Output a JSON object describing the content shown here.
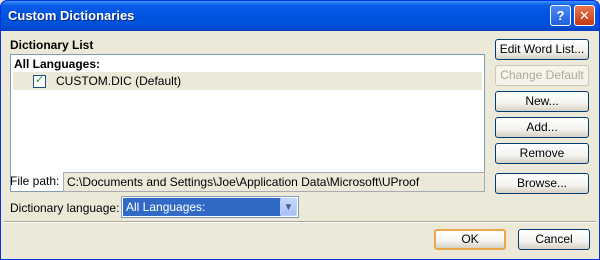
{
  "window": {
    "title": "Custom Dictionaries",
    "help_glyph": "?",
    "close_glyph": "✕"
  },
  "list": {
    "label": "Dictionary List",
    "group_header": "All Languages:",
    "items": [
      {
        "label": "CUSTOM.DIC (Default)",
        "checked": true
      }
    ]
  },
  "buttons": {
    "edit_word_list": "Edit Word List...",
    "change_default": "Change Default",
    "new": "New...",
    "add": "Add...",
    "remove": "Remove",
    "browse": "Browse...",
    "ok": "OK",
    "cancel": "Cancel"
  },
  "file_path": {
    "label": "File path:",
    "value": "C:\\Documents and Settings\\Joe\\Application Data\\Microsoft\\UProof"
  },
  "language": {
    "label": "Dictionary language:",
    "selected": "All Languages:"
  },
  "colors": {
    "title_bar": "#0053e0",
    "face": "#ece9d8",
    "selection": "#316ac5",
    "check": "#21a121"
  }
}
